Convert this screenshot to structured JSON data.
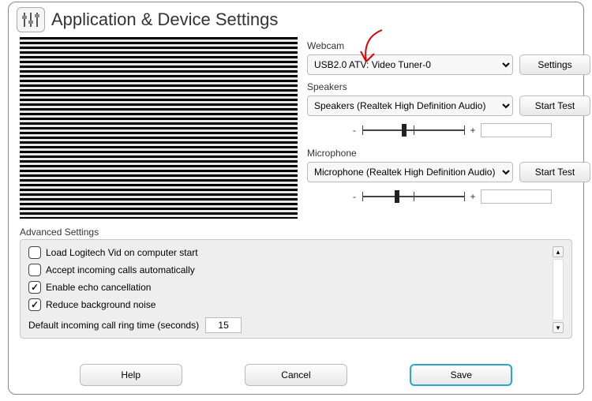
{
  "title": "Application & Device Settings",
  "webcam": {
    "label": "Webcam",
    "selected": "USB2.0 ATV: Video Tuner-0",
    "settings_btn": "Settings"
  },
  "speakers": {
    "label": "Speakers",
    "selected": "Speakers (Realtek High Definition Audio)",
    "test_btn": "Start Test",
    "slider_pos_pct": 40
  },
  "microphone": {
    "label": "Microphone",
    "selected": "Microphone (Realtek High Definition Audio)",
    "test_btn": "Start Test",
    "slider_pos_pct": 33
  },
  "advanced": {
    "label": "Advanced Settings",
    "load_on_start": {
      "label": "Load Logitech Vid on computer start",
      "checked": false
    },
    "auto_accept": {
      "label": "Accept incoming calls automatically",
      "checked": false
    },
    "echo_cancel": {
      "label": "Enable echo cancellation",
      "checked": true
    },
    "reduce_noise": {
      "label": "Reduce background noise",
      "checked": true
    },
    "ring_label": "Default incoming call ring time (seconds)",
    "ring_value": "15"
  },
  "footer": {
    "help": "Help",
    "cancel": "Cancel",
    "save": "Save"
  },
  "glyphs": {
    "minus": "-",
    "plus": "+"
  }
}
